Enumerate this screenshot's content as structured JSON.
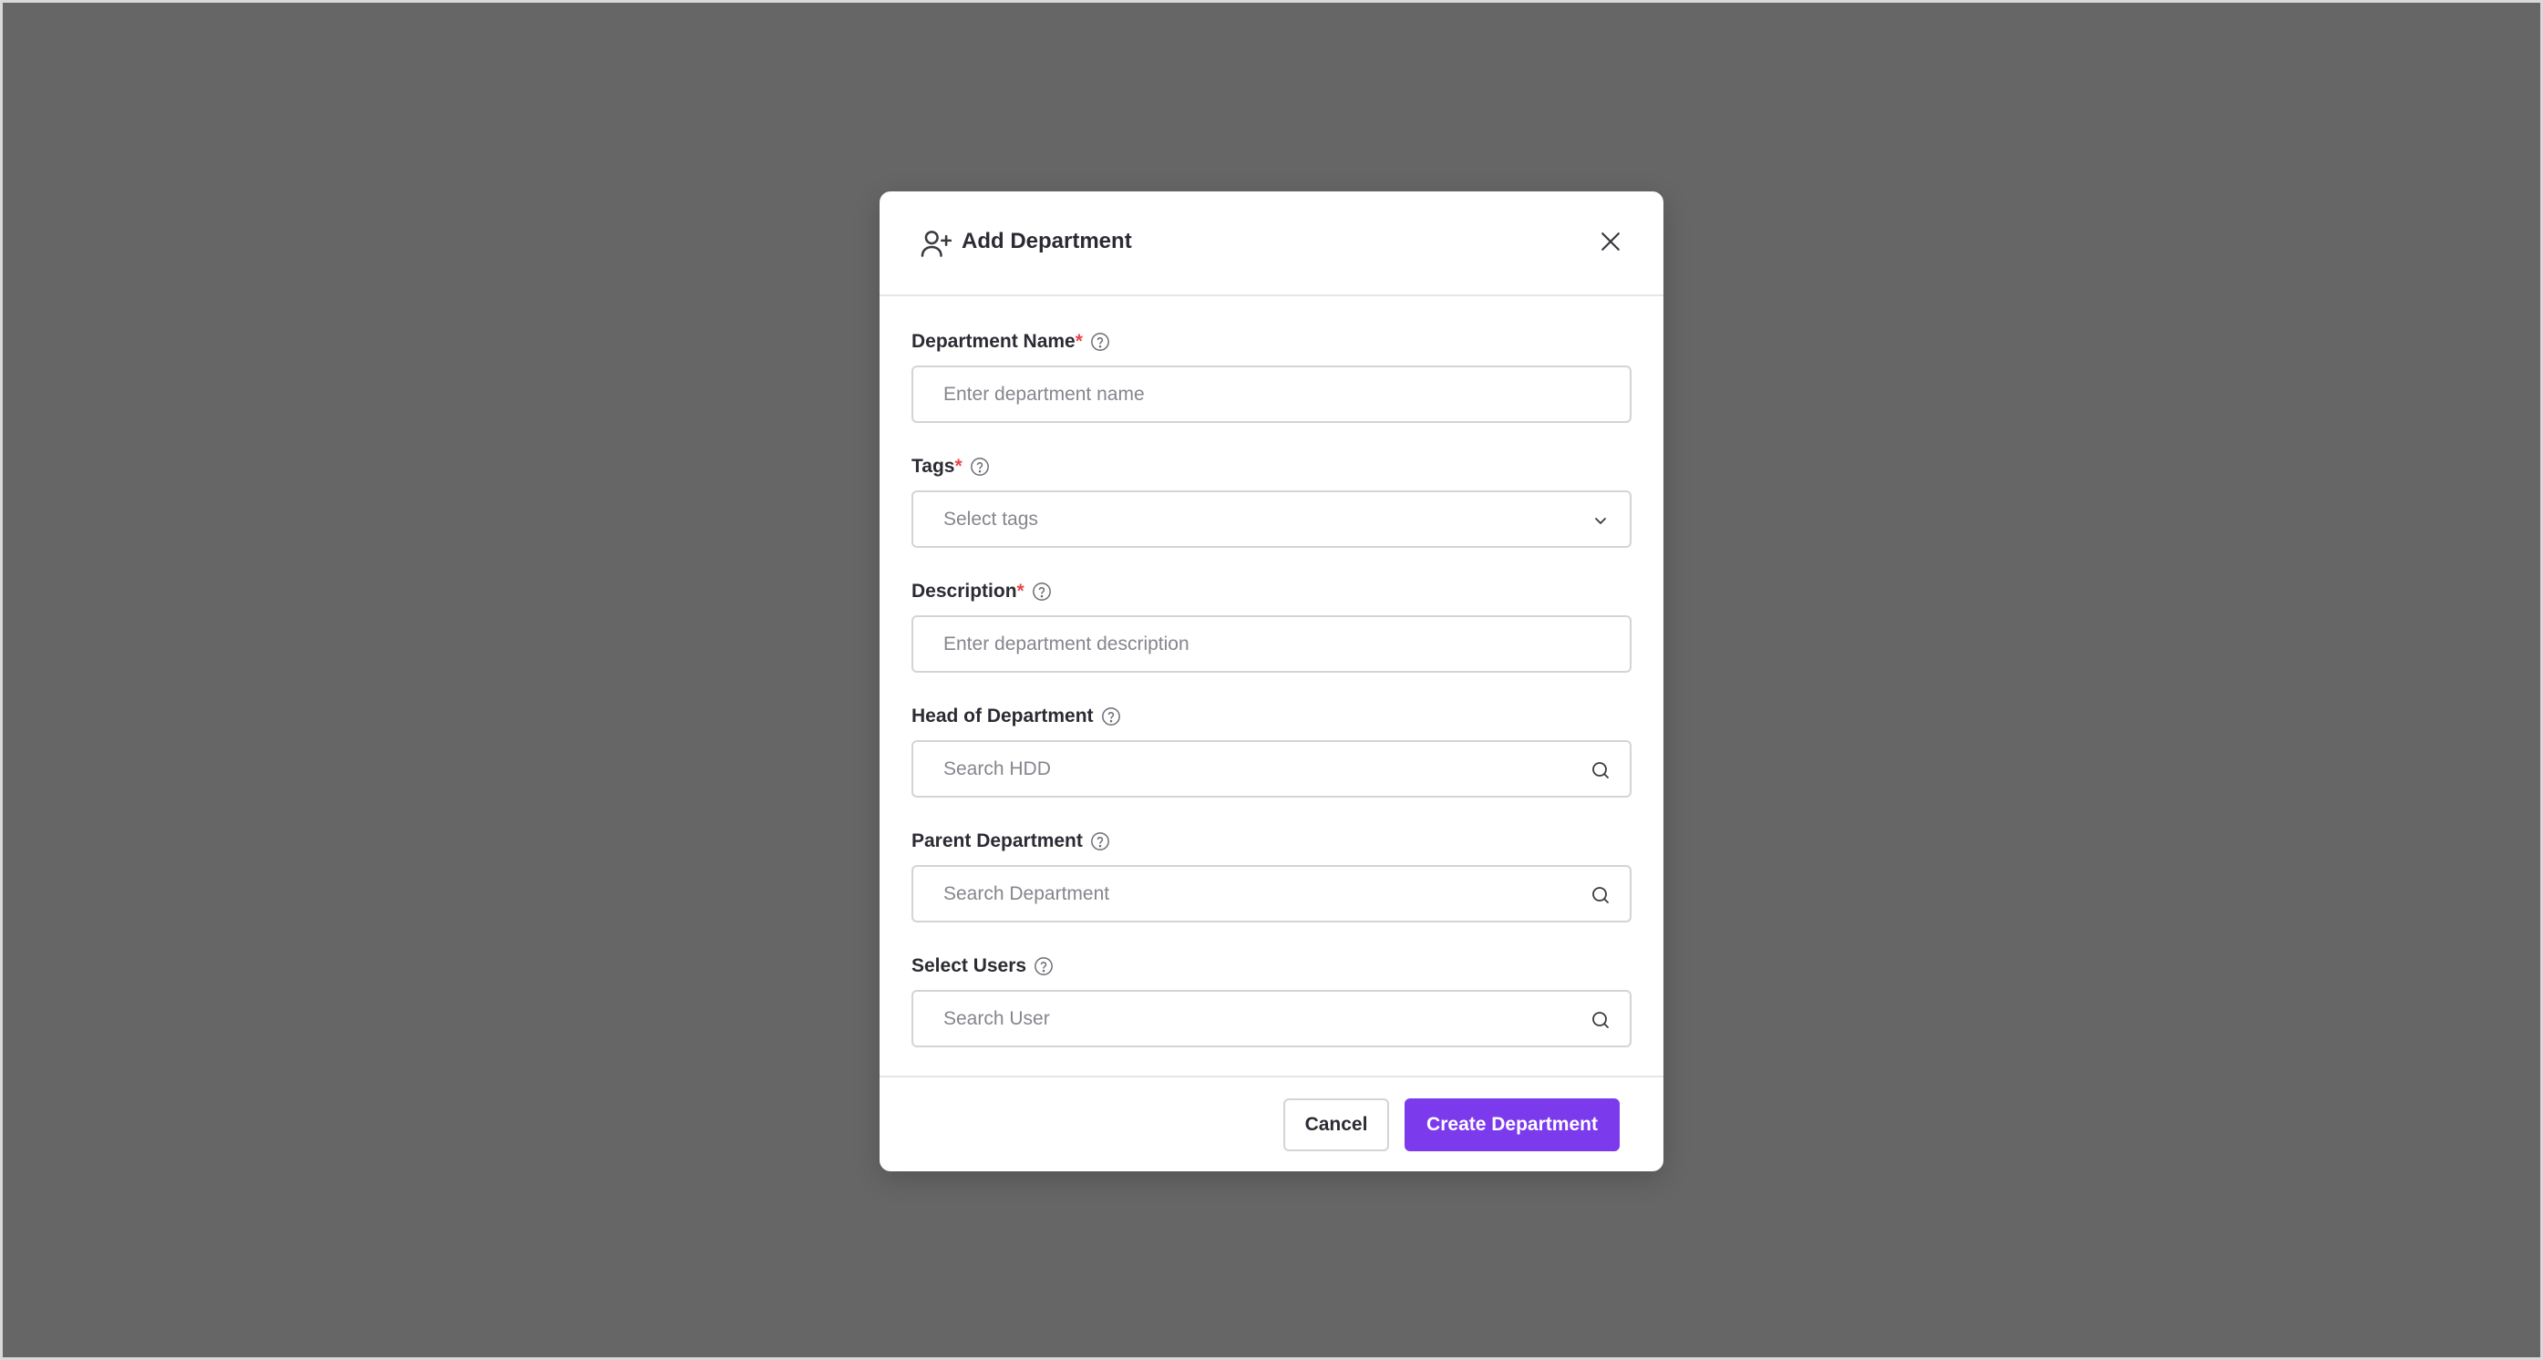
{
  "modal": {
    "title": "Add Department",
    "header_icon": "user-plus-icon",
    "close_icon": "close-icon"
  },
  "fields": {
    "department_name": {
      "label": "Department Name",
      "required": "*",
      "placeholder": "Enter department name",
      "value": ""
    },
    "tags": {
      "label": "Tags",
      "required": "*",
      "placeholder": "Select tags"
    },
    "description": {
      "label": "Description",
      "required": "*",
      "placeholder": "Enter department description",
      "value": ""
    },
    "head_of_department": {
      "label": "Head of Department",
      "placeholder": "Search HDD",
      "value": ""
    },
    "parent_department": {
      "label": "Parent Department",
      "placeholder": "Search Department",
      "value": ""
    },
    "select_users": {
      "label": "Select Users",
      "placeholder": "Search User",
      "value": ""
    }
  },
  "footer": {
    "cancel_label": "Cancel",
    "submit_label": "Create Department"
  },
  "colors": {
    "backdrop": "#666666",
    "primary": "#7c3aed",
    "required": "#e5484d",
    "border": "#d4d4d8",
    "placeholder": "#85858d"
  }
}
